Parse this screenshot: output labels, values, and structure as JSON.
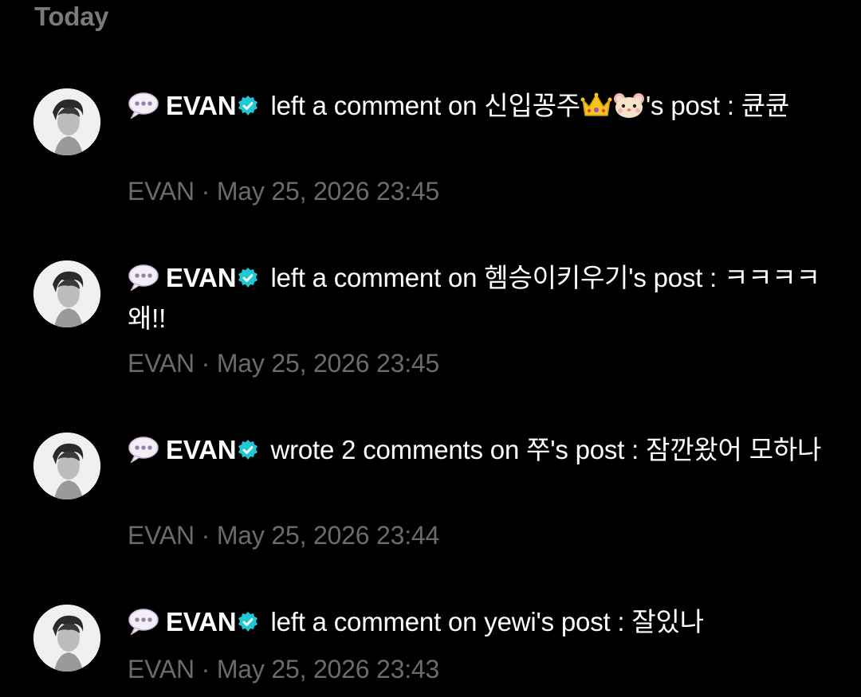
{
  "header": {
    "section_title": "Today"
  },
  "notifications": [
    {
      "author": "EVAN",
      "action_text": "left a comment on 신입꽁주",
      "emojis": [
        "crown-emoji",
        "hamster-emoji"
      ],
      "post_suffix": "'s post : 큔큔",
      "meta_author": "EVAN",
      "separator": "·",
      "timestamp": "May 25, 2026 23:45"
    },
    {
      "author": "EVAN",
      "action_text": "left a comment on 헴승이키우기's post : ㅋㅋㅋㅋ 왜!!",
      "meta_author": "EVAN",
      "separator": "·",
      "timestamp": "May 25, 2026 23:45"
    },
    {
      "author": "EVAN",
      "action_text": "wrote 2 comments on 쭈's post : 잠깐왔어 모하나",
      "meta_author": "EVAN",
      "separator": "·",
      "timestamp": "May 25, 2026 23:44"
    },
    {
      "author": "EVAN",
      "action_text": "left a comment on yewi's post : 잘있나",
      "meta_author": "EVAN",
      "separator": "·",
      "timestamp": "May 25, 2026 23:43"
    }
  ],
  "icons": {
    "chat": "speech-bubble-icon",
    "verified": "verified-badge-icon",
    "avatar": "profile-photo"
  },
  "colors": {
    "background": "#000000",
    "text": "#ffffff",
    "meta": "#6b6b6b",
    "header": "#7a7a7a",
    "verified": "#1ec8d6"
  }
}
